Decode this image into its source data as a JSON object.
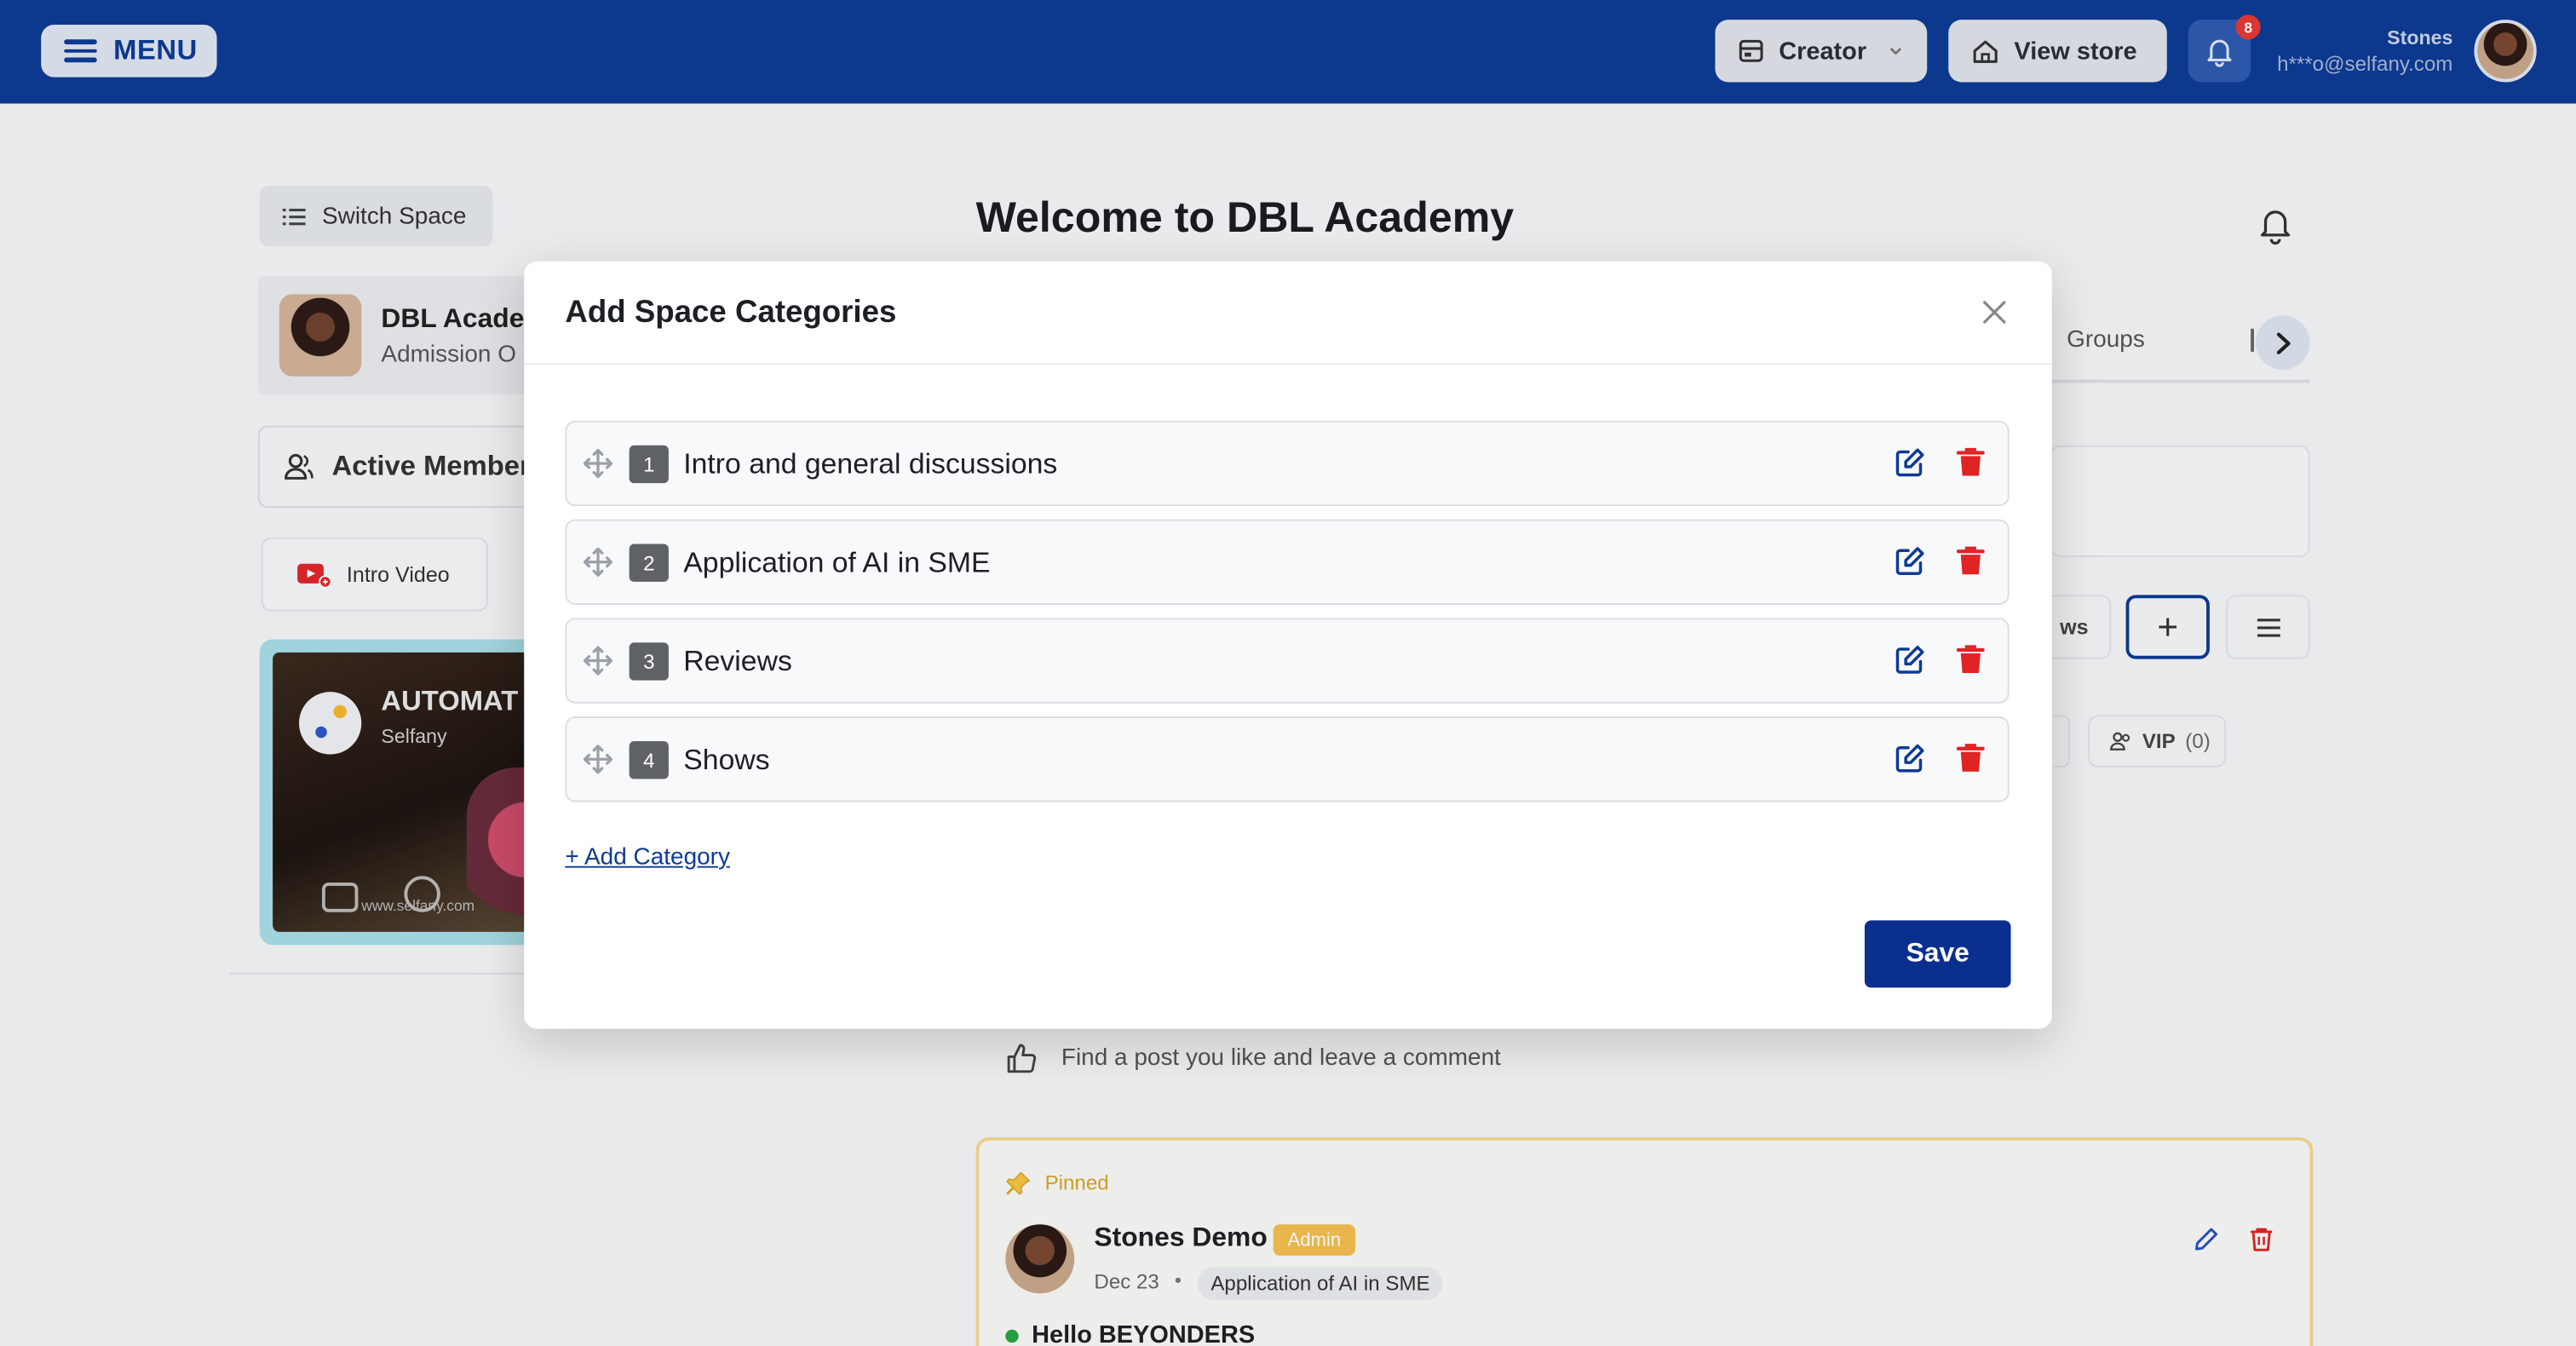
{
  "topbar": {
    "menu_label": "MENU",
    "creator_label": "Creator",
    "view_store_label": "View store",
    "notifications_count": "8",
    "user_name": "Stones",
    "user_email": "h***o@selfany.com"
  },
  "sidebar": {
    "switch_space_label": "Switch Space",
    "space_title": "DBL Acade",
    "space_subtitle": "Admission O",
    "active_members_label": "Active Member",
    "intro_video_label": "Intro Video",
    "video_title": "AUTOMAT",
    "video_brand": "Selfany",
    "video_url": "www.selfany.com"
  },
  "page": {
    "welcome_title": "Welcome to DBL Academy",
    "tab_groups": "Groups",
    "ws_label": "ws",
    "vip_label": "VIP",
    "vip_count": "(0)",
    "find_post_text": "Find a post you like and leave a comment"
  },
  "post": {
    "pinned_label": "Pinned",
    "author": "Stones Demo",
    "role_badge": "Admin",
    "date": "Dec 23",
    "separator": "•",
    "category": "Application of AI in SME",
    "title": "Hello BEYONDERS"
  },
  "modal": {
    "title": "Add Space Categories",
    "categories": [
      {
        "index": "1",
        "label": "Intro and general discussions"
      },
      {
        "index": "2",
        "label": "Application of AI in SME"
      },
      {
        "index": "3",
        "label": "Reviews"
      },
      {
        "index": "4",
        "label": "Shows"
      }
    ],
    "add_category_label": "+ Add Category",
    "save_label": "Save"
  },
  "colors": {
    "brand": "#0d3b94",
    "danger": "#e02424",
    "pinned": "#d6a627",
    "admin_badge": "#f4bf4f"
  }
}
